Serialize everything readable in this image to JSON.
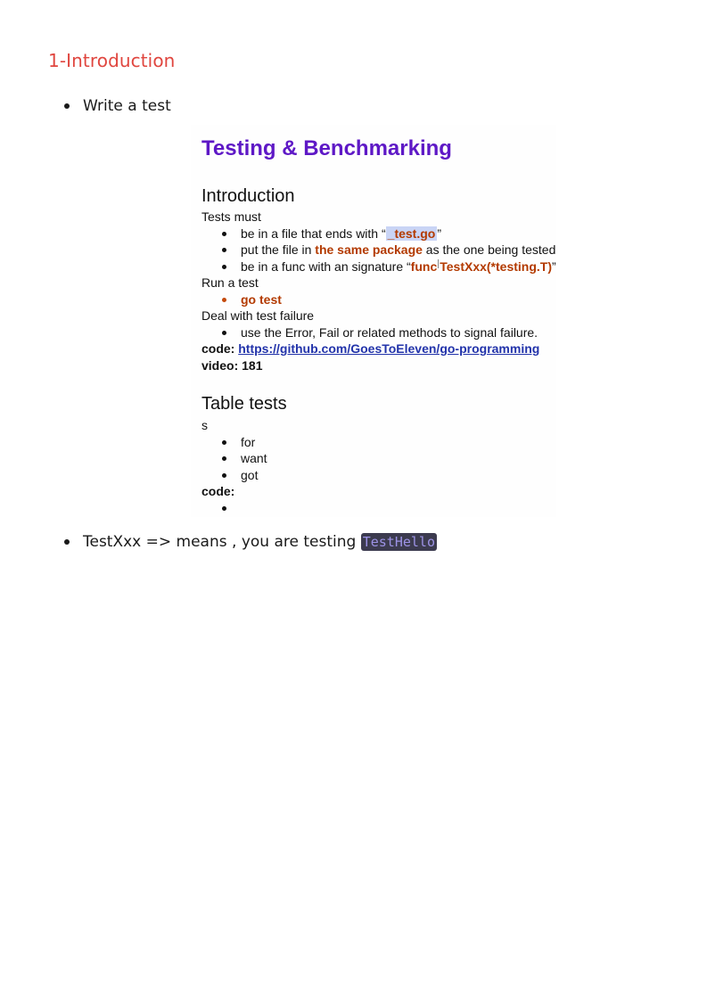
{
  "heading": "1-Introduction",
  "bullets": [
    {
      "text": "Write a test"
    },
    {
      "text_before": "TestXxx => means , you are testing",
      "code": "TestHello"
    }
  ],
  "slide": {
    "title": "Testing & Benchmarking",
    "intro": {
      "heading": "Introduction",
      "tests_must": "Tests must",
      "b1_prefix": "be in a file that ends with “",
      "b1_code": "_test.go",
      "b1_suffix": "”",
      "b2_prefix": "put the file in ",
      "b2_bold": "the same package",
      "b2_suffix": " as the one being tested",
      "b3_prefix": "be in a func with an signature “",
      "b3_code1": "func",
      "b3_code2": "TestXxx(*testing.T)",
      "b3_suffix": "”",
      "run_a_test": "Run a test",
      "run_item": "go test",
      "deal": "Deal with test failure",
      "deal_item": "use the Error, Fail or related methods to signal failure.",
      "code_label": "code:",
      "code_link": "https://github.com/GoesToEleven/go-programming",
      "video_label": "video: 181"
    },
    "table": {
      "heading": "Table tests",
      "s": "s",
      "items": [
        "for",
        "want",
        "got"
      ],
      "code_label": "code:"
    }
  },
  "colors": {
    "heading": "#e0463f",
    "slide_title": "#5e18c6",
    "code_highlight": "#b33a00",
    "link": "#2233aa",
    "inline_code_bg": "#3c3b4f",
    "inline_code_fg": "#9d93e6"
  }
}
